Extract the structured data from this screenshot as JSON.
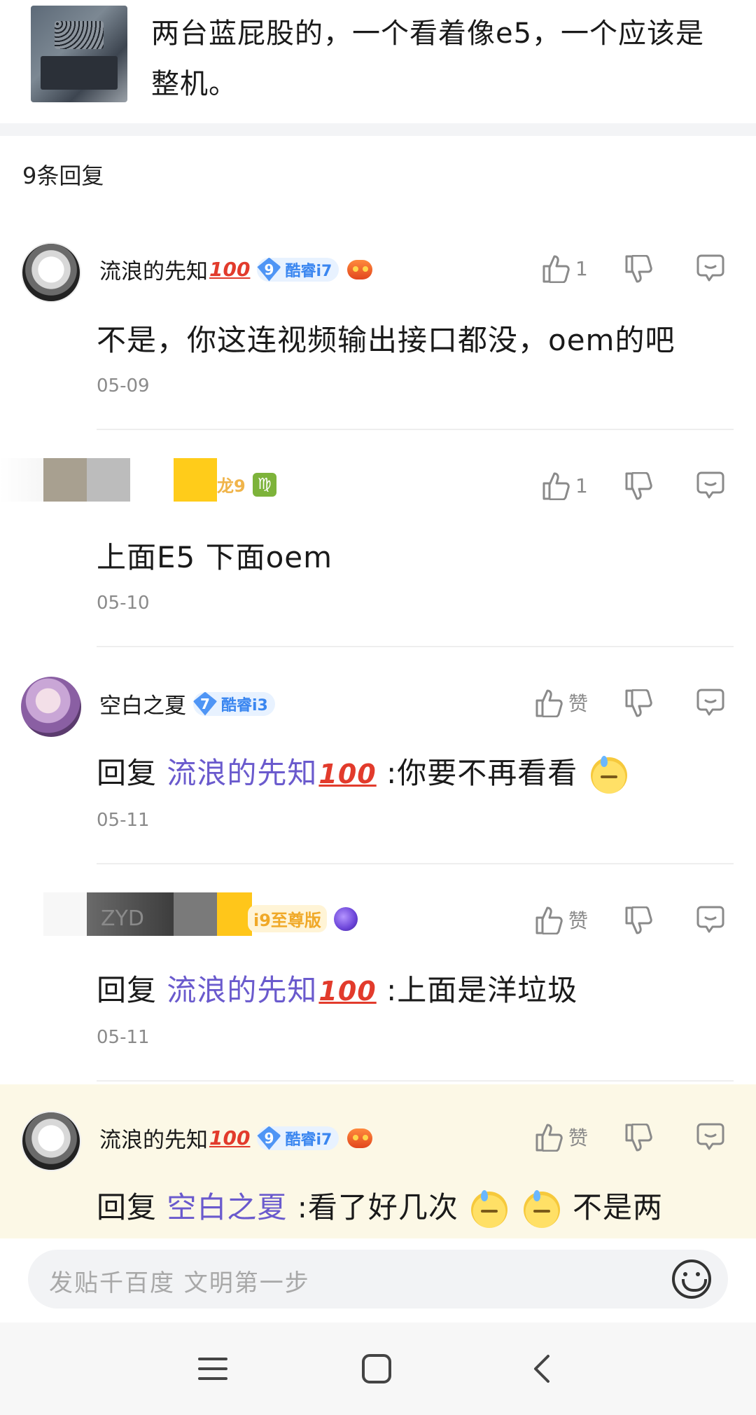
{
  "post": {
    "text": "两台蓝屁股的，一个看着像e5，一个应该是整机。"
  },
  "reply_count": "9条回复",
  "comments": [
    {
      "username": "流浪的先知",
      "has_100": true,
      "level": "9",
      "level_title": "酷睿i7",
      "likes": "1",
      "content": "不是，你这连视频输出接口都没，oem的吧",
      "date": "05-09"
    },
    {
      "username_partial": "龙9",
      "likes": "1",
      "content": "上面E5 下面oem",
      "date": "05-10"
    },
    {
      "username": "空白之夏",
      "level": "7",
      "level_title": "酷睿i3",
      "likes": "赞",
      "reply_prefix": "回复",
      "mention": "流浪的先知",
      "content": ":你要不再看看",
      "date": "05-11"
    },
    {
      "username_partial": "ZYD",
      "level_title": "i9至尊版",
      "likes": "赞",
      "reply_prefix": "回复",
      "mention": "流浪的先知",
      "content": ":上面是洋垃圾",
      "date": "05-11"
    },
    {
      "username": "流浪的先知",
      "level": "9",
      "level_title": "酷睿i7",
      "likes": "赞",
      "reply_prefix": "回复",
      "mention": "空白之夏",
      "content_a": ":看了好几次",
      "content_b": "不是两"
    }
  ],
  "input": {
    "placeholder": "发贴千百度 文明第一步"
  },
  "hundred_mark": "100",
  "zodiac_symbol": "♍",
  "colors": {
    "mention": "#6a5acd",
    "badge_blue": "#3a86f0",
    "highlight_bg": "#fcf8e6"
  }
}
